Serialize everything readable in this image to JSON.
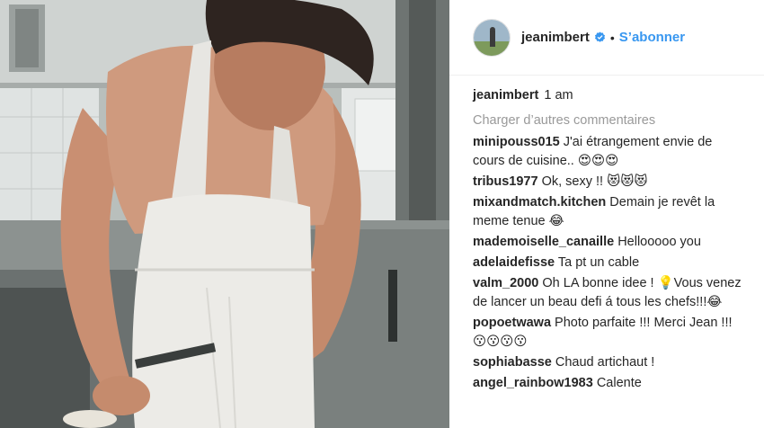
{
  "post": {
    "username": "jeanimbert",
    "separator": "•",
    "follow_label": "S’abonner",
    "verified_icon": "verified-badge-icon",
    "accent_color": "#3897f0",
    "caption_user": "jeanimbert",
    "caption_time": "1 am",
    "load_more_label": "Charger d’autres commentaires"
  },
  "comments": [
    {
      "user": "minipouss015",
      "text": "J'ai étrangement envie de cours de cuisine.. 😍😍😍"
    },
    {
      "user": "tribus1977",
      "text": "Ok, sexy !! 😻😻😻"
    },
    {
      "user": "mixandmatch.kitchen",
      "text": "Demain je revêt la meme tenue 😂"
    },
    {
      "user": "mademoiselle_canaille",
      "text": "Hellooooo you"
    },
    {
      "user": "adelaidefisse",
      "text": "Ta pt un cable"
    },
    {
      "user": "valm_2000",
      "text": "Oh LA bonne idee ! 💡Vous venez de lancer un beau defi á tous les chefs!!!😂"
    },
    {
      "user": "popoetwawa",
      "text": "Photo parfaite !!! Merci Jean !!! 😗😗😗😗"
    },
    {
      "user": "sophiabasse",
      "text": "Chaud artichaut !"
    },
    {
      "user": "angel_rainbow1983",
      "text": "Calente"
    }
  ]
}
